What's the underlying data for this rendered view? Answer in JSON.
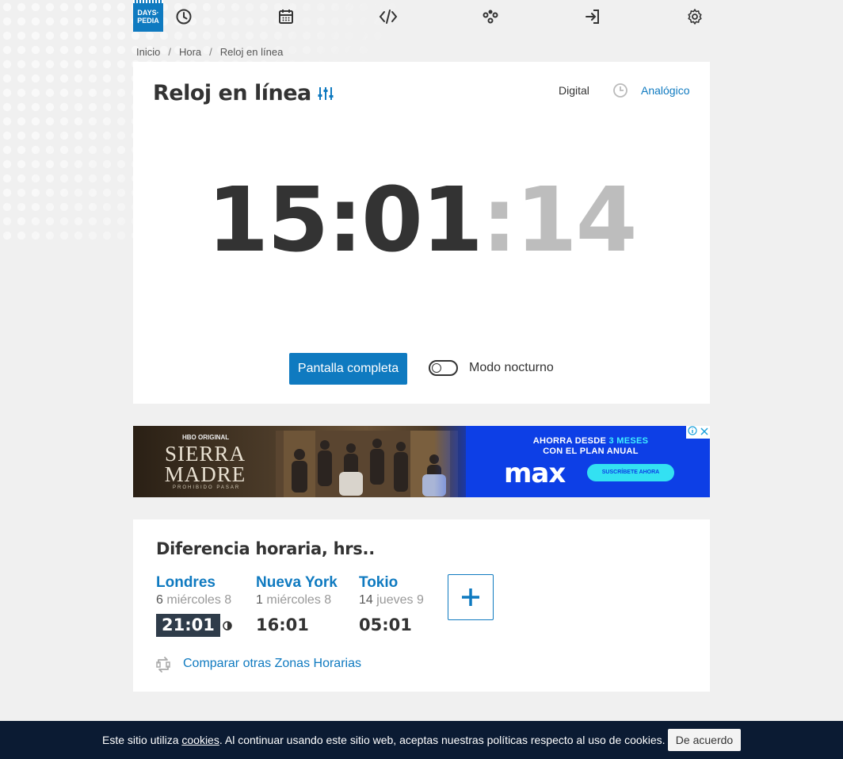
{
  "logo": {
    "line1": "DAYS·",
    "line2": "PEDIA"
  },
  "nav": {
    "icons": [
      "clock-icon",
      "calendar-icon",
      "code-icon",
      "network-icon",
      "login-icon",
      "gear-icon"
    ]
  },
  "breadcrumb": {
    "items": [
      "Inicio",
      "Hora",
      "Reloj en línea"
    ],
    "separator": "/"
  },
  "clock": {
    "title": "Reloj en línea",
    "mode_digital": "Digital",
    "mode_analog": "Analógico",
    "time_hm": "15:01",
    "time_sec": ":14",
    "fullscreen_label": "Pantalla completa",
    "night_mode_label": "Modo nocturno",
    "night_mode_on": false
  },
  "ad": {
    "hbo": "HBO ORIGINAL",
    "title_line1": "SIERRA",
    "title_line2": "MADRE",
    "subtitle": "PROHIBIDO PASAR",
    "promo_line1_a": "AHORRA DESDE ",
    "promo_line1_b": "3 MESES",
    "promo_line2": "CON EL PLAN ANUAL",
    "brand": "max",
    "cta": "SUSCRÍBETE AHORA"
  },
  "timezones": {
    "title": "Diferencia horaria, hrs..",
    "cities": [
      {
        "name": "Londres",
        "diff": "6",
        "day": "miércoles 8",
        "time": "21:01",
        "night": true
      },
      {
        "name": "Nueva York",
        "diff": "1",
        "day": "miércoles 8",
        "time": "16:01",
        "night": false
      },
      {
        "name": "Tokio",
        "diff": "14",
        "day": "jueves 9",
        "time": "05:01",
        "night": false
      }
    ],
    "compare_label": "Comparar otras Zonas Horarias"
  },
  "cookie": {
    "text_before": "Este sitio utiliza ",
    "link": "cookies",
    "text_after": ". Al continuar usando este sitio web, aceptas nuestras políticas respecto al uso de cookies.",
    "button": "De acuerdo"
  },
  "colors": {
    "accent": "#0f7ac0",
    "cookie_bar": "#0b1b33",
    "ad_bg": "#0d3fe6"
  }
}
